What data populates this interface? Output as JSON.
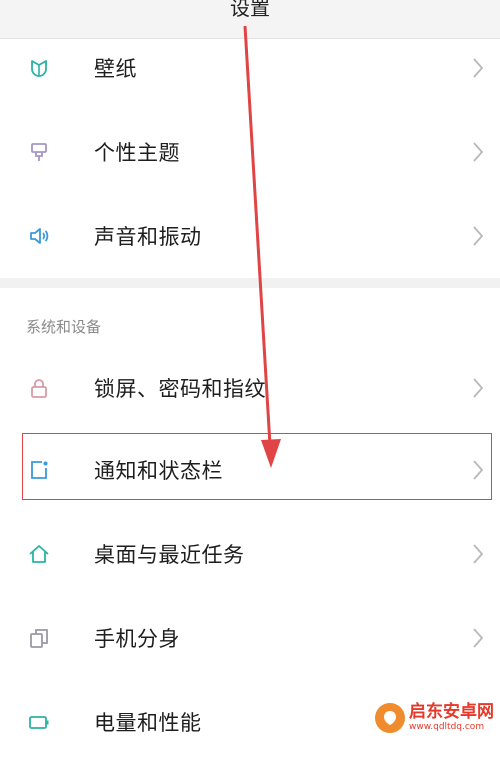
{
  "header": {
    "title": "设置"
  },
  "rows_group1": [
    {
      "label": "壁纸",
      "icon": "wallpaper-icon"
    },
    {
      "label": "个性主题",
      "icon": "theme-brush-icon"
    },
    {
      "label": "声音和振动",
      "icon": "speaker-icon"
    }
  ],
  "section": {
    "title": "系统和设备"
  },
  "rows_group2": [
    {
      "label": "锁屏、密码和指纹",
      "icon": "lock-icon"
    },
    {
      "label": "通知和状态栏",
      "icon": "notification-icon",
      "highlighted": true
    },
    {
      "label": "桌面与最近任务",
      "icon": "home-icon"
    },
    {
      "label": "手机分身",
      "icon": "dual-apps-icon"
    },
    {
      "label": "电量和性能",
      "icon": "battery-icon"
    }
  ],
  "annotation": {
    "arrow_color": "#e04444",
    "box_color": "#e04444"
  },
  "watermark": {
    "name": "启东安卓网",
    "url": "www.qdltdq.com"
  },
  "colors": {
    "accent": "#2bb3a3",
    "lock": "#d99aa3",
    "theme": "#a596c8",
    "sound": "#3a9ad9",
    "dual": "#9a9aa6",
    "battery": "#2bb3a3"
  }
}
